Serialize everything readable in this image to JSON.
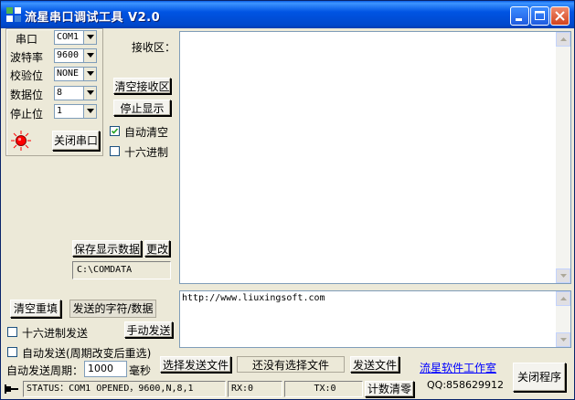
{
  "window": {
    "title": "流星串口调试工具 V2.0",
    "icon": "app-grid-icon",
    "controls": [
      "minimize-icon",
      "maximize-icon",
      "close-icon"
    ]
  },
  "settings": {
    "port_label": "串口",
    "port_value": "COM1",
    "baud_label": "波特率",
    "baud_value": "9600",
    "parity_label": "校验位",
    "parity_value": "NONE",
    "databits_label": "数据位",
    "databits_value": "8",
    "stopbits_label": "停止位",
    "stopbits_value": "1",
    "close_port_label": "关闭串口",
    "status_indicator_color": "#FF0000"
  },
  "receive": {
    "area_label": "接收区：",
    "clear_label": "清空接收区",
    "stop_display_label": "停止显示",
    "auto_clear_label": "自动清空",
    "auto_clear_checked": true,
    "hex_label": "十六进制",
    "hex_checked": false,
    "content": ""
  },
  "save": {
    "save_label": "保存显示数据",
    "change_label": "更改",
    "path": "C:\\COMDATA"
  },
  "send": {
    "clear_label": "清空重填",
    "send_chars_label": "发送的字符/数据",
    "hex_send_label": "十六进制发送",
    "hex_send_checked": false,
    "manual_send_label": "手动发送",
    "auto_send_label": "自动发送(周期改变后重选)",
    "auto_send_checked": false,
    "period_label": "自动发送周期：",
    "period_value": "1000",
    "period_unit": "毫秒",
    "content": "http://www.liuxingsoft.com"
  },
  "file": {
    "select_label": "选择发送文件",
    "status_text": "还没有选择文件",
    "send_file_label": "发送文件"
  },
  "about": {
    "studio_link": "流星软件工作室",
    "qq": "QQ:858629912",
    "exit_label": "关闭程序"
  },
  "statusbar": {
    "status": "STATUS：COM1 OPENED，9600,N,8,1",
    "rx": "RX:0",
    "tx": "TX:0",
    "reset_counter_label": "计数清零"
  }
}
